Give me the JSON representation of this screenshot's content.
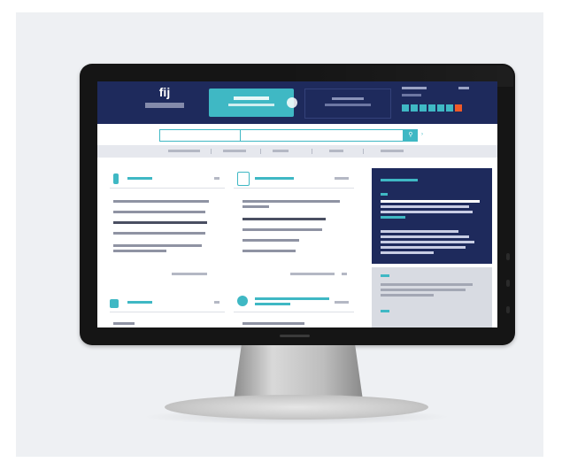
{
  "scene": {
    "background_color": "#eef0f3",
    "monitor_color": "#151515"
  },
  "site": {
    "brand_colors": {
      "header": "#1e2a5c",
      "accent": "#3fb8c4"
    },
    "logo_mark": "fij",
    "search": {
      "select_placeholder": "",
      "input_placeholder": ""
    },
    "icons": {
      "search_button": "search-icon",
      "advanced": "chevron-right-icon"
    }
  }
}
